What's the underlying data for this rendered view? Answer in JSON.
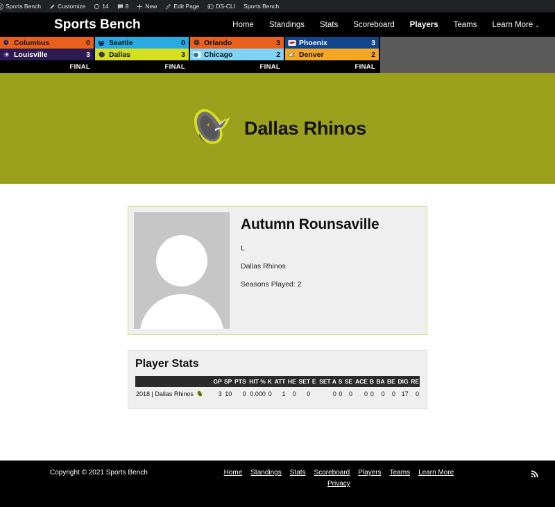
{
  "adminbar": {
    "items": [
      {
        "icon": "wordpress-icon",
        "label": "Sports Bench"
      },
      {
        "icon": "pencil-icon",
        "label": "Customize"
      },
      {
        "icon": "update-ring-icon",
        "label": "14"
      },
      {
        "icon": "comment-bubble-icon",
        "label": "8"
      },
      {
        "icon": "plus-icon",
        "label": "New"
      },
      {
        "icon": "edit-pen-icon",
        "label": "Edit Page"
      },
      {
        "icon": "dscli-icon",
        "label": "DS-CLI"
      },
      {
        "icon": "none",
        "label": "Sports Bench"
      }
    ]
  },
  "header": {
    "brand": "Sports Bench",
    "nav": [
      {
        "label": "Home",
        "active": false
      },
      {
        "label": "Standings",
        "active": false
      },
      {
        "label": "Stats",
        "active": false
      },
      {
        "label": "Scoreboard",
        "active": false
      },
      {
        "label": "Players",
        "active": true
      },
      {
        "label": "Teams",
        "active": false
      },
      {
        "label": "Learn More",
        "active": false,
        "caret": "⌄"
      }
    ]
  },
  "scoreboard": {
    "games": [
      {
        "away": {
          "team": "Columbus",
          "score": "0",
          "bg": "#e8601c",
          "fg": "#111111",
          "logo_primary": "#2b2a6e",
          "logo_secondary": "#e8601c"
        },
        "home": {
          "team": "Louisville",
          "score": "3",
          "bg": "#2b1b52",
          "fg": "#ffffff",
          "logo_primary": "#6b3fa0",
          "logo_secondary": "#ffffff"
        },
        "status": "FINAL"
      },
      {
        "away": {
          "team": "Seattle",
          "score": "0",
          "bg": "#29abe2",
          "fg": "#111111",
          "logo_primary": "#1b2a5e",
          "logo_secondary": "#29abe2"
        },
        "home": {
          "team": "Dallas",
          "score": "3",
          "bg": "#d6e021",
          "fg": "#111111",
          "logo_primary": "#3a3a3a",
          "logo_secondary": "#d6e021"
        },
        "status": "FINAL"
      },
      {
        "away": {
          "team": "Orlando",
          "score": "3",
          "bg": "#e8601c",
          "fg": "#111111",
          "logo_primary": "#4a2c10",
          "logo_secondary": "#e8601c"
        },
        "home": {
          "team": "Chicago",
          "score": "2",
          "bg": "#7fd4f5",
          "fg": "#111111",
          "logo_primary": "#2a6fb0",
          "logo_secondary": "#ffffff"
        },
        "status": "FINAL"
      },
      {
        "away": {
          "team": "Phoenix",
          "score": "3",
          "bg": "#12458c",
          "fg": "#ffffff",
          "logo_primary": "#d22030",
          "logo_secondary": "#ffffff"
        },
        "home": {
          "team": "Denver",
          "score": "2",
          "bg": "#f5a623",
          "fg": "#111111",
          "logo_primary": "#ffffff",
          "logo_secondary": "#1b3a6b"
        },
        "status": "FINAL"
      }
    ]
  },
  "hero": {
    "team_name": "Dallas Rhinos",
    "bg_color": "#9aa01c",
    "logo": "rhino-logo-icon"
  },
  "player": {
    "name": "Autumn Rounsaville",
    "position": "L",
    "team": "Dallas Rhinos",
    "seasons": "Seasons Played: 2",
    "photo": "player-photo-placeholder"
  },
  "player_stats": {
    "title": "Player Stats",
    "columns": [
      "",
      "GP",
      "SP",
      "PTS",
      "HIT %",
      "K",
      "ATT",
      "HE",
      "SET",
      "E",
      "SET A",
      "S",
      "SE",
      "ACE",
      "B",
      "BA",
      "BE",
      "DIG",
      "RE"
    ],
    "rows": [
      {
        "label": "2018 | Dallas Rhinos",
        "logo": "rhino-row-logo-icon",
        "values": [
          "3",
          "10",
          "0",
          "0.000",
          "0",
          "1",
          "0",
          "0",
          "",
          "0",
          "0",
          "0",
          "0",
          "0",
          "0",
          "0",
          "17",
          "0"
        ]
      }
    ]
  },
  "footer": {
    "copyright": "Copyright © 2021 Sports Bench",
    "nav": [
      {
        "label": "Home"
      },
      {
        "label": "Standings"
      },
      {
        "label": "Stats"
      },
      {
        "label": "Scoreboard"
      },
      {
        "label": "Players"
      },
      {
        "label": "Teams"
      },
      {
        "label": "Learn More"
      }
    ],
    "nav2": [
      {
        "label": "Privacy"
      }
    ],
    "rss_icon": "rss-feed-icon"
  }
}
